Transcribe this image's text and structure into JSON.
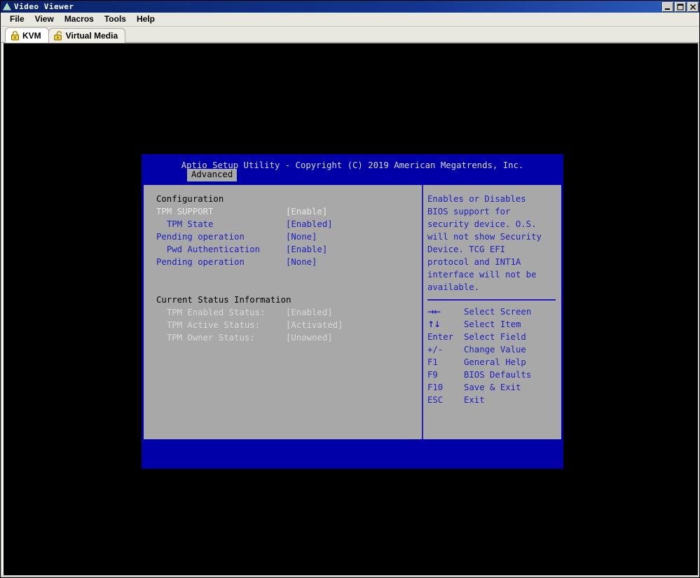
{
  "window": {
    "title": "Video Viewer",
    "icon": "video-viewer-icon",
    "minimize_label": "minimize-icon",
    "maximize_label": "maximize-icon",
    "close_label": "close-icon"
  },
  "menu": {
    "items": [
      {
        "label": "File"
      },
      {
        "label": "View"
      },
      {
        "label": "Macros"
      },
      {
        "label": "Tools"
      },
      {
        "label": "Help"
      }
    ]
  },
  "tabs": [
    {
      "label": "KVM",
      "icon": "lock-closed-icon",
      "active": true
    },
    {
      "label": "Virtual Media",
      "icon": "lock-open-icon",
      "active": false
    }
  ],
  "bios": {
    "header": "Aptio Setup Utility - Copyright (C) 2019 American Megatrends, Inc.",
    "active_tab": "Advanced",
    "left_panel": {
      "section1_title": "Configuration",
      "section1_rows": [
        {
          "label": "TPM SUPPORT",
          "value": "[Enable]",
          "indent": 0,
          "selected": true
        },
        {
          "label": "TPM State",
          "value": "[Enabled]",
          "indent": 1,
          "selected": false
        },
        {
          "label": "Pending operation",
          "value": "[None]",
          "indent": 0,
          "selected": false
        },
        {
          "label": "Pwd Authentication",
          "value": "[Enable]",
          "indent": 1,
          "selected": false
        },
        {
          "label": "Pending operation",
          "value": "[None]",
          "indent": 0,
          "selected": false
        }
      ],
      "section2_title": "Current Status Information",
      "section2_rows": [
        {
          "label": "TPM Enabled Status:",
          "value": "[Enabled]"
        },
        {
          "label": "TPM Active Status:",
          "value": "[Activated]"
        },
        {
          "label": "TPM Owner Status:",
          "value": "[Unowned]"
        }
      ]
    },
    "right_panel": {
      "help_lines": [
        "Enables or Disables",
        "BIOS support for",
        "security device. O.S.",
        "will not show Security",
        "Device. TCG EFI",
        "protocol and INT1A",
        "interface will not be",
        "available."
      ],
      "keys": [
        {
          "key": "→←",
          "desc": "Select Screen",
          "glyph": true
        },
        {
          "key": "↑↓",
          "desc": "Select Item",
          "glyph": true
        },
        {
          "key": "Enter",
          "desc": "Select Field",
          "glyph": false
        },
        {
          "key": "+/-",
          "desc": "Change Value",
          "glyph": false
        },
        {
          "key": "F1",
          "desc": "General Help",
          "glyph": false
        },
        {
          "key": "F9",
          "desc": "BIOS Defaults",
          "glyph": false
        },
        {
          "key": "F10",
          "desc": "Save & Exit",
          "glyph": false
        },
        {
          "key": "ESC",
          "desc": "Exit",
          "glyph": false
        }
      ]
    }
  },
  "colors": {
    "bios_background": "#0000a8",
    "bios_panel": "#a8a8a8",
    "bios_text_blue": "#2020c0",
    "bios_text_selected": "#e8e8e8",
    "title_bar": "#0a246a",
    "window_chrome": "#d4d0c8"
  }
}
